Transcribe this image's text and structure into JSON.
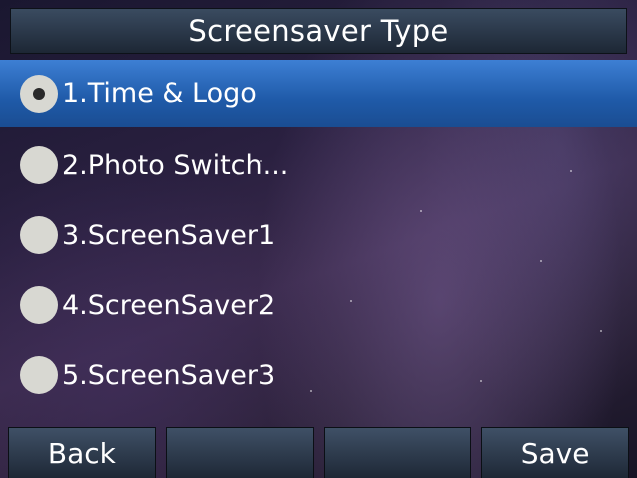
{
  "title": "Screensaver Type",
  "options": [
    {
      "label": "1.Time & Logo",
      "selected": true
    },
    {
      "label": "2.Photo Switch...",
      "selected": false
    },
    {
      "label": "3.ScreenSaver1",
      "selected": false
    },
    {
      "label": "4.ScreenSaver2",
      "selected": false
    },
    {
      "label": "5.ScreenSaver3",
      "selected": false
    }
  ],
  "softkeys": {
    "back": "Back",
    "blank1": "",
    "blank2": "",
    "save": "Save"
  },
  "colors": {
    "selection": "#2a6cc2",
    "radio": "#d8d8d2"
  }
}
